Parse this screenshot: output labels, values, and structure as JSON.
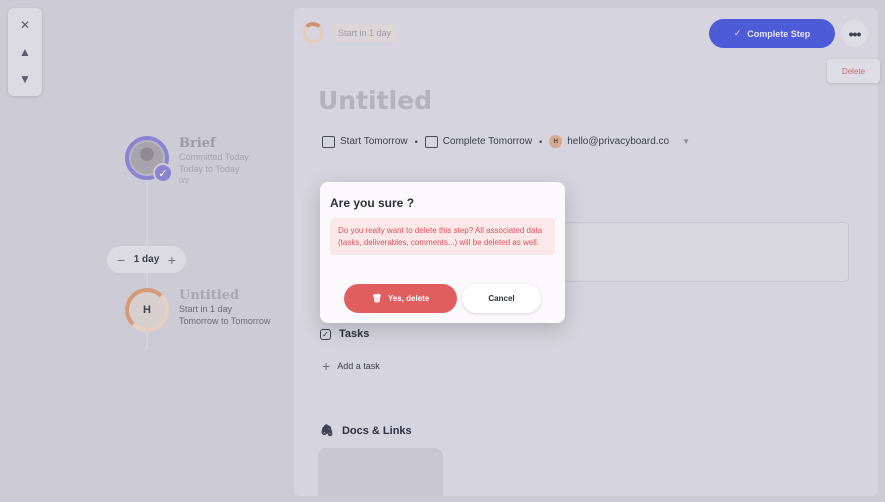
{
  "sidebar": {
    "tools": [
      {
        "icon": "close-icon",
        "glyph": "✕"
      },
      {
        "icon": "arrow-up-icon",
        "glyph": "▲"
      },
      {
        "icon": "arrow-down-icon",
        "glyph": "▼"
      }
    ]
  },
  "timeline": {
    "steps": [
      {
        "title": "Brief",
        "line1": "Committed Today",
        "line2": "Today to Today",
        "line3": "0/2"
      },
      {
        "title": "Untitled",
        "initial": "H",
        "line1": "Start in 1 day",
        "line2": "Tomorrow to Tomorrow"
      }
    ],
    "duration": {
      "minus": "−",
      "label": "1 day",
      "plus": "+"
    }
  },
  "panel": {
    "start_chip": "Start in 1 day",
    "complete_label": "Complete Step",
    "more_label": "•••",
    "delete_label": "Delete",
    "heading": "Untitled",
    "meta": {
      "start": "Start Tomorrow",
      "complete": "Complete Tomorrow",
      "owner_initial": "H",
      "owner_email": "hello@privacyboard.co"
    },
    "tasks_label": "Tasks",
    "add_task_label": "Add a task",
    "docs_label": "Docs & Links"
  },
  "modal": {
    "title": "Are you sure ?",
    "warning": "Do you really want to delete this step? All associated data (tasks, deliverables, comments...) will be deleted as well.",
    "confirm_label": "Yes, delete",
    "cancel_label": "Cancel"
  },
  "colors": {
    "primary": "#4d5bd7",
    "danger": "#e15e5e",
    "warning_bg": "#fbe8e9"
  }
}
